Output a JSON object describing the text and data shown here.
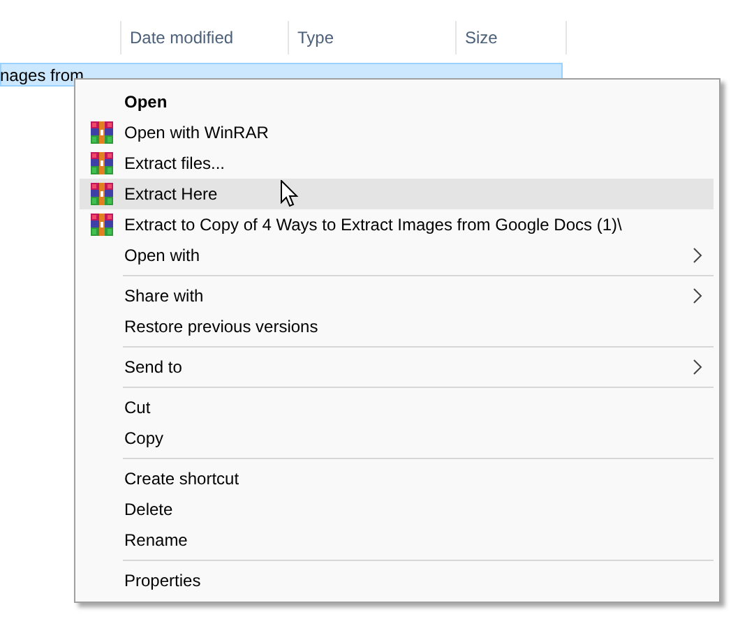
{
  "file_list": {
    "columns": [
      "Date modified",
      "Type",
      "Size"
    ],
    "rows": [
      {
        "name": "nages from",
        "selected": true
      }
    ]
  },
  "context_menu": {
    "items": [
      {
        "kind": "command",
        "label": "Open",
        "default": true,
        "submenu": false,
        "selected": false
      },
      {
        "kind": "archive-command",
        "label": "Open with WinRAR",
        "default": false,
        "submenu": false,
        "selected": false
      },
      {
        "kind": "archive-command",
        "label": "Extract files...",
        "default": false,
        "submenu": false,
        "selected": false
      },
      {
        "kind": "archive-command",
        "label": "Extract Here",
        "default": false,
        "submenu": false,
        "selected": true
      },
      {
        "kind": "archive-command",
        "label": "Extract to Copy of 4 Ways to Extract Images from Google Docs (1)\\",
        "default": false,
        "submenu": false,
        "selected": false
      },
      {
        "kind": "command",
        "label": "Open with",
        "default": false,
        "submenu": true,
        "selected": false
      },
      {
        "kind": "separator"
      },
      {
        "kind": "command",
        "label": "Share with",
        "default": false,
        "submenu": true,
        "selected": false
      },
      {
        "kind": "command",
        "label": "Restore previous versions",
        "default": false,
        "submenu": false,
        "selected": false
      },
      {
        "kind": "separator"
      },
      {
        "kind": "command",
        "label": "Send to",
        "default": false,
        "submenu": true,
        "selected": false
      },
      {
        "kind": "separator"
      },
      {
        "kind": "command",
        "label": "Cut",
        "default": false,
        "submenu": false,
        "selected": false
      },
      {
        "kind": "command",
        "label": "Copy",
        "default": false,
        "submenu": false,
        "selected": false
      },
      {
        "kind": "separator"
      },
      {
        "kind": "command",
        "label": "Create shortcut",
        "default": false,
        "submenu": false,
        "selected": false
      },
      {
        "kind": "command",
        "label": "Delete",
        "default": false,
        "submenu": false,
        "selected": false
      },
      {
        "kind": "command",
        "label": "Rename",
        "default": false,
        "submenu": false,
        "selected": false
      },
      {
        "kind": "separator"
      },
      {
        "kind": "command",
        "label": "Properties",
        "default": false,
        "submenu": false,
        "selected": false
      }
    ]
  }
}
